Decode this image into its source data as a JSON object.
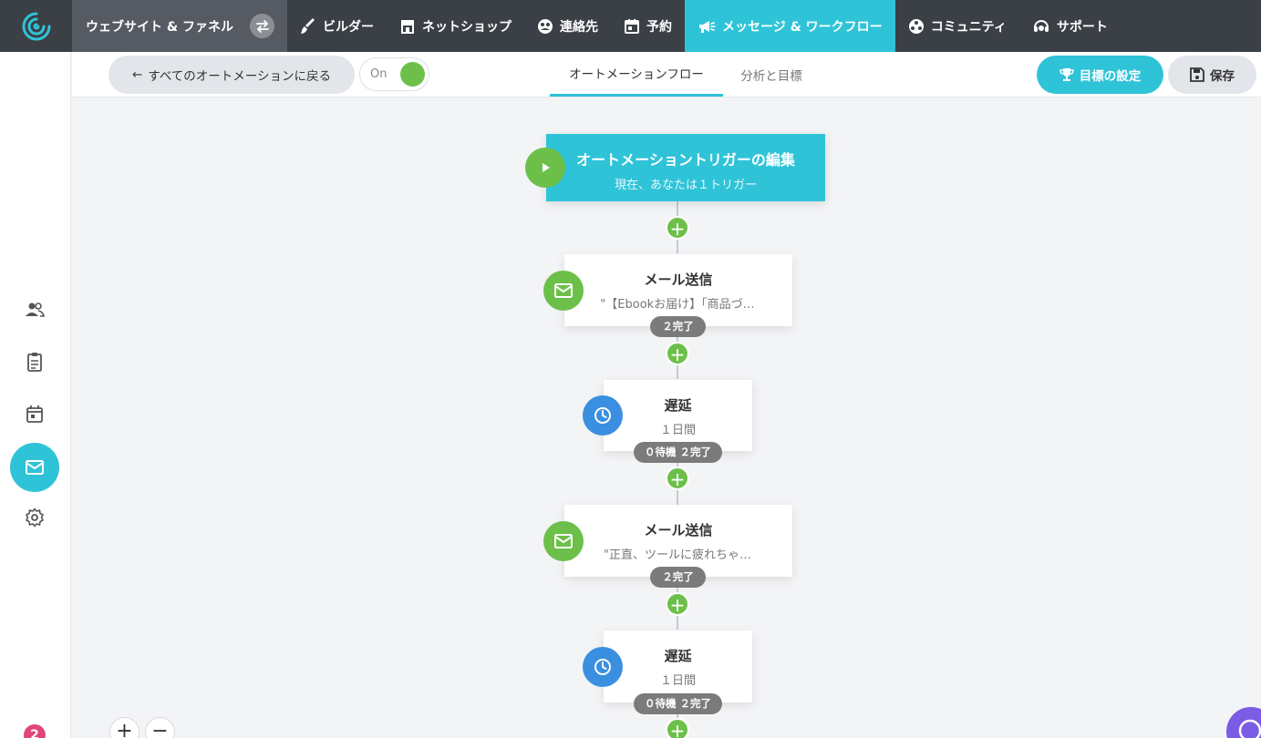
{
  "topnav": {
    "site_label": "ウェブサイト & ファネル",
    "items": [
      {
        "label": "ビルダー",
        "icon": "brush-icon"
      },
      {
        "label": "ネットショップ",
        "icon": "store-icon"
      },
      {
        "label": "連絡先",
        "icon": "contacts-icon"
      },
      {
        "label": "予約",
        "icon": "calendar-icon"
      },
      {
        "label": "メッセージ & ワークフロー",
        "icon": "megaphone-icon"
      },
      {
        "label": "コミュニティ",
        "icon": "community-icon"
      },
      {
        "label": "サポート",
        "icon": "support-icon"
      }
    ],
    "active_color": "#2fc3d8"
  },
  "sidebar": {
    "help_count": "2"
  },
  "subbar": {
    "back_label": "すべてのオートメーションに戻る",
    "toggle_label": "On",
    "tabs": [
      {
        "label": "オートメーションフロー"
      },
      {
        "label": "分析と目標"
      }
    ],
    "goal_label": "目標の設定",
    "save_label": "保存"
  },
  "flow": {
    "trigger": {
      "title": "オートメーショントリガーの編集",
      "subtitle": "現在、あなたは１トリガー"
    },
    "steps": [
      {
        "title": "メール送信",
        "subtitle": "\"【Ebookお届け】「商品づ…",
        "badge": "２完了"
      },
      {
        "title": "遅延",
        "subtitle": "１日間",
        "badge": "０待機  ２完了"
      },
      {
        "title": "メール送信",
        "subtitle": "\"正直、ツールに疲れちゃ…",
        "badge": "２完了"
      },
      {
        "title": "遅延",
        "subtitle": "１日間",
        "badge": "０待機  ２完了"
      }
    ]
  },
  "zoom": {
    "in": "+",
    "out": "−"
  }
}
